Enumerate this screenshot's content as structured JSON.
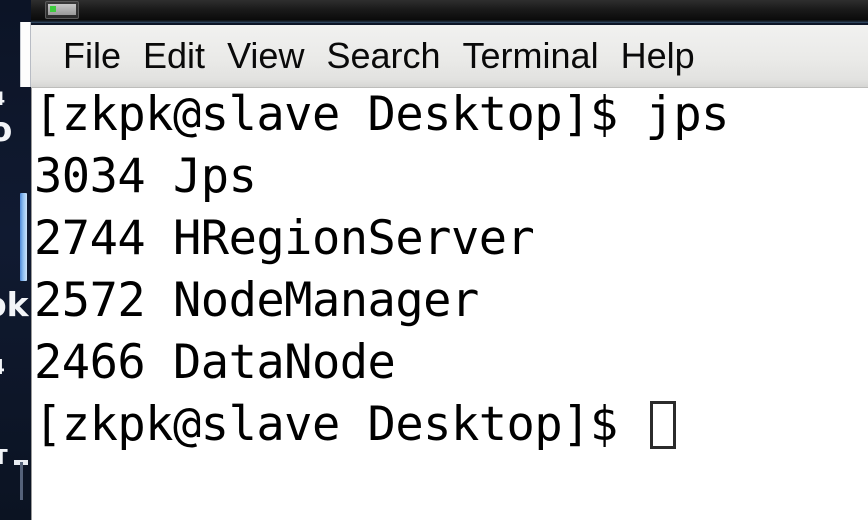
{
  "window": {
    "title_bar_icon": "terminal-icon",
    "menus": [
      {
        "label": "File"
      },
      {
        "label": "Edit"
      },
      {
        "label": "View"
      },
      {
        "label": "Search"
      },
      {
        "label": "Terminal"
      },
      {
        "label": "Help"
      }
    ]
  },
  "terminal": {
    "lines": [
      {
        "text": "[zkpk@slave Desktop]$ jps",
        "cursor": false
      },
      {
        "text": "3034 Jps",
        "cursor": false
      },
      {
        "text": "2744 HRegionServer",
        "cursor": false
      },
      {
        "text": "2572 NodeManager",
        "cursor": false
      },
      {
        "text": "2466 DataNode",
        "cursor": false
      },
      {
        "text": "[zkpk@slave Desktop]$ ",
        "cursor": true
      }
    ],
    "prompt": "[zkpk@slave Desktop]$",
    "command": "jps",
    "processes": [
      {
        "pid": "3034",
        "name": "Jps"
      },
      {
        "pid": "2744",
        "name": "HRegionServer"
      },
      {
        "pid": "2572",
        "name": "NodeManager"
      },
      {
        "pid": "2466",
        "name": "DataNode"
      }
    ]
  },
  "background": {
    "fragments": [
      {
        "text": "4"
      },
      {
        "text": "o"
      },
      {
        "text": "ok"
      },
      {
        "text": "4"
      },
      {
        "text": "T"
      }
    ]
  },
  "colors": {
    "desktop": "#0d1628",
    "terminal_bg": "#ffffff",
    "terminal_fg": "#000000",
    "menubar_bg": "#eaeae8",
    "titlebar_bg": "#111111",
    "accent_blue": "#8fc0f2"
  }
}
